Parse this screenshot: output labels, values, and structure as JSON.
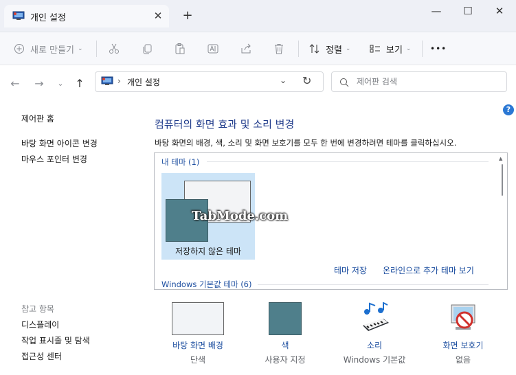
{
  "window": {
    "tab_title": "개인 설정",
    "close_tab": "✕",
    "new_tab": "+",
    "minimize": "—",
    "maximize": "☐",
    "close": "✕"
  },
  "commandbar": {
    "new": "새로 만들기",
    "sort": "정렬",
    "view": "보기",
    "more": "•••"
  },
  "address": {
    "breadcrumb": "개인 설정",
    "separator": "›",
    "search_placeholder": "제어판 검색"
  },
  "sidebar": {
    "home": "제어판 홈",
    "links": [
      "바탕 화면 아이콘 변경",
      "마우스 포인터 변경"
    ],
    "see_also_title": "참고 항목",
    "see_also": [
      "디스플레이",
      "작업 표시줄 및 탐색",
      "접근성 센터"
    ]
  },
  "main": {
    "title": "컴퓨터의 화면 효과 및 소리 변경",
    "description": "바탕 화면의 배경, 색, 소리 및 화면 보호기를 모두 한 번에 변경하려면 테마를 클릭하십시오.",
    "my_themes_title": "내 테마 (1)",
    "unsaved_theme": "저장하지 않은 테마",
    "save_theme": "테마 저장",
    "get_more_online": "온라인으로 추가 테마 보기",
    "windows_default_title": "Windows 기본값 테마 (6)",
    "watermark": "TabMode.com"
  },
  "bottom": [
    {
      "title": "바탕 화면 배경",
      "sub": "단색"
    },
    {
      "title": "색",
      "sub": "사용자 지정"
    },
    {
      "title": "소리",
      "sub": "Windows 기본값"
    },
    {
      "title": "화면 보호기",
      "sub": "없음"
    }
  ],
  "colors": {
    "link": "#1e4fa0",
    "heading": "#1e3a8a",
    "selected_tile": "#cce4f7",
    "titlebar": "#eef0f6"
  }
}
